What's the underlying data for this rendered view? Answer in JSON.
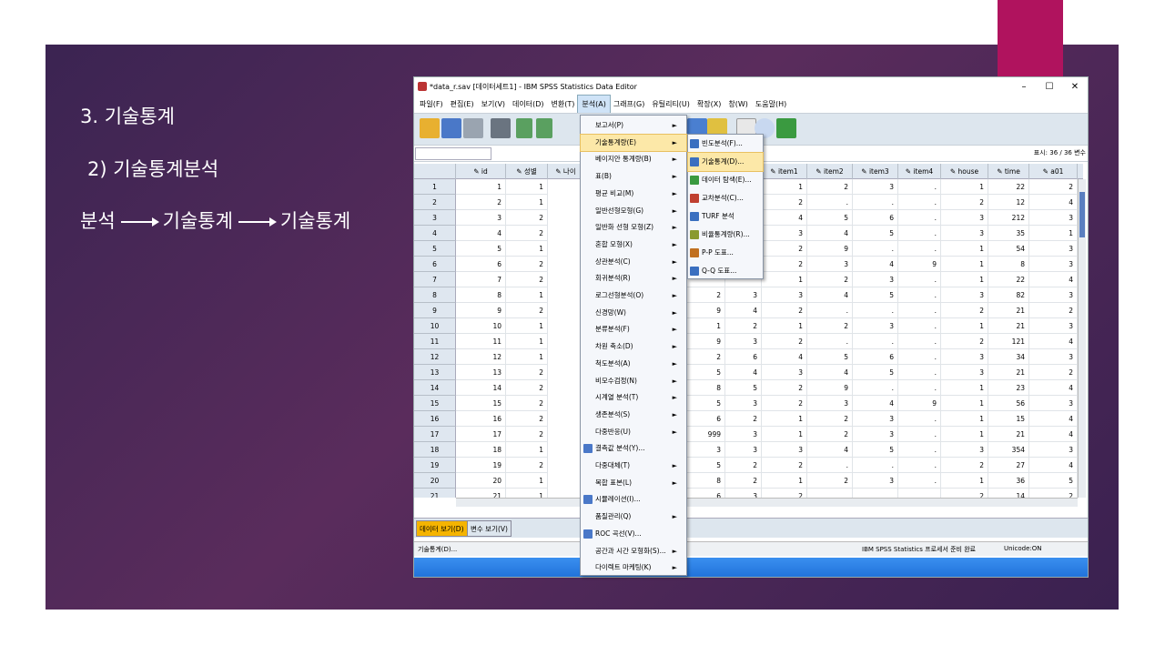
{
  "slide": {
    "heading": "3. 기술통계",
    "subheading": "2) 기술통계분석",
    "path": [
      "분석",
      "기술통계",
      "기술통계"
    ],
    "colors": {
      "background": "#4a2858",
      "accent": "#b0135e"
    }
  },
  "window": {
    "title": "*data_r.sav [데이터세트1] - IBM SPSS Statistics Data Editor",
    "controls": [
      "–",
      "☐",
      "✕"
    ],
    "menus": [
      "파일(F)",
      "편집(E)",
      "보기(V)",
      "데이터(D)",
      "변환(T)",
      "분석(A)",
      "그래프(G)",
      "유틸리티(U)",
      "확장(X)",
      "창(W)",
      "도움말(H)"
    ],
    "active_menu": "분석(A)",
    "display_info": "표시: 36 / 36 변수"
  },
  "grid": {
    "columns": [
      "id",
      "성별",
      "나이",
      "item1",
      "item2",
      "item3",
      "item4",
      "house",
      "time",
      "a01"
    ],
    "hidden_cols": [
      "",
      ""
    ],
    "rows": [
      {
        "n": "1",
        "id": "1",
        "sex": "1",
        "h1": "",
        "h2": "",
        "item1": "1",
        "item2": "2",
        "item3": "3",
        "item4": ".",
        "house": "1",
        "time": "22",
        "a01": "2"
      },
      {
        "n": "2",
        "id": "2",
        "sex": "1",
        "h1": "",
        "h2": "",
        "item1": "2",
        "item2": ".",
        "item3": ".",
        "item4": ".",
        "house": "2",
        "time": "12",
        "a01": "4"
      },
      {
        "n": "3",
        "id": "3",
        "sex": "2",
        "h1": "",
        "h2": "",
        "item1": "4",
        "item2": "5",
        "item3": "6",
        "item4": ".",
        "house": "3",
        "time": "212",
        "a01": "3"
      },
      {
        "n": "4",
        "id": "4",
        "sex": "2",
        "h1": "",
        "h2": "",
        "item1": "3",
        "item2": "4",
        "item3": "5",
        "item4": ".",
        "house": "3",
        "time": "35",
        "a01": "1"
      },
      {
        "n": "5",
        "id": "5",
        "sex": "1",
        "h1": "",
        "h2": "",
        "item1": "2",
        "item2": "9",
        "item3": ".",
        "item4": ".",
        "house": "1",
        "time": "54",
        "a01": "3"
      },
      {
        "n": "6",
        "id": "6",
        "sex": "2",
        "h1": "",
        "h2": "",
        "item1": "2",
        "item2": "3",
        "item3": "4",
        "item4": "9",
        "house": "1",
        "time": "8",
        "a01": "3"
      },
      {
        "n": "7",
        "id": "7",
        "sex": "2",
        "h1": "",
        "h2": "",
        "item1": "1",
        "item2": "2",
        "item3": "3",
        "item4": ".",
        "house": "1",
        "time": "22",
        "a01": "4"
      },
      {
        "n": "8",
        "id": "8",
        "sex": "1",
        "h1": "2",
        "h2": "3",
        "item1": "3",
        "item2": "4",
        "item3": "5",
        "item4": ".",
        "house": "3",
        "time": "82",
        "a01": "3"
      },
      {
        "n": "9",
        "id": "9",
        "sex": "2",
        "h1": "9",
        "h2": "4",
        "item1": "2",
        "item2": ".",
        "item3": ".",
        "item4": ".",
        "house": "2",
        "time": "21",
        "a01": "2"
      },
      {
        "n": "10",
        "id": "10",
        "sex": "1",
        "h1": "1",
        "h2": "2",
        "item1": "1",
        "item2": "2",
        "item3": "3",
        "item4": ".",
        "house": "1",
        "time": "21",
        "a01": "3"
      },
      {
        "n": "11",
        "id": "11",
        "sex": "1",
        "h1": "9",
        "h2": "3",
        "item1": "2",
        "item2": ".",
        "item3": ".",
        "item4": ".",
        "house": "2",
        "time": "121",
        "a01": "4"
      },
      {
        "n": "12",
        "id": "12",
        "sex": "1",
        "h1": "2",
        "h2": "6",
        "item1": "4",
        "item2": "5",
        "item3": "6",
        "item4": ".",
        "house": "3",
        "time": "34",
        "a01": "3"
      },
      {
        "n": "13",
        "id": "13",
        "sex": "2",
        "h1": "5",
        "h2": "4",
        "item1": "3",
        "item2": "4",
        "item3": "5",
        "item4": ".",
        "house": "3",
        "time": "21",
        "a01": "2"
      },
      {
        "n": "14",
        "id": "14",
        "sex": "2",
        "h1": "8",
        "h2": "5",
        "item1": "2",
        "item2": "9",
        "item3": ".",
        "item4": ".",
        "house": "1",
        "time": "23",
        "a01": "4"
      },
      {
        "n": "15",
        "id": "15",
        "sex": "2",
        "h1": "5",
        "h2": "3",
        "item1": "2",
        "item2": "3",
        "item3": "4",
        "item4": "9",
        "house": "1",
        "time": "56",
        "a01": "3"
      },
      {
        "n": "16",
        "id": "16",
        "sex": "2",
        "h1": "6",
        "h2": "2",
        "item1": "1",
        "item2": "2",
        "item3": "3",
        "item4": ".",
        "house": "1",
        "time": "15",
        "a01": "4"
      },
      {
        "n": "17",
        "id": "17",
        "sex": "2",
        "h1": "999",
        "h2": "3",
        "item1": "1",
        "item2": "2",
        "item3": "3",
        "item4": ".",
        "house": "1",
        "time": "21",
        "a01": "4"
      },
      {
        "n": "18",
        "id": "18",
        "sex": "1",
        "h1": "3",
        "h2": "3",
        "item1": "3",
        "item2": "4",
        "item3": "5",
        "item4": ".",
        "house": "3",
        "time": "354",
        "a01": "3"
      },
      {
        "n": "19",
        "id": "19",
        "sex": "2",
        "h1": "5",
        "h2": "2",
        "item1": "2",
        "item2": ".",
        "item3": ".",
        "item4": ".",
        "house": "2",
        "time": "27",
        "a01": "4"
      },
      {
        "n": "20",
        "id": "20",
        "sex": "1",
        "h1": "8",
        "h2": "2",
        "item1": "1",
        "item2": "2",
        "item3": "3",
        "item4": ".",
        "house": "1",
        "time": "36",
        "a01": "5"
      },
      {
        "n": "21",
        "id": "21",
        "sex": "1",
        "h1": "6",
        "h2": "3",
        "item1": "2",
        "item2": "",
        "item3": "",
        "item4": "",
        "house": "2",
        "time": "14",
        "a01": "2"
      }
    ]
  },
  "analyze_menu": [
    {
      "label": "보고서(P)",
      "sub": true,
      "icon": ""
    },
    {
      "label": "기술통계량(E)",
      "sub": true,
      "icon": "",
      "highlighted": true
    },
    {
      "label": "베이지안 통계량(B)",
      "sub": true,
      "icon": ""
    },
    {
      "label": "표(B)",
      "sub": true,
      "icon": ""
    },
    {
      "label": "평균 비교(M)",
      "sub": true,
      "icon": ""
    },
    {
      "label": "일반선형모형(G)",
      "sub": true,
      "icon": ""
    },
    {
      "label": "일반화 선형 모형(Z)",
      "sub": true,
      "icon": ""
    },
    {
      "label": "혼합 모형(X)",
      "sub": true,
      "icon": ""
    },
    {
      "label": "상관분석(C)",
      "sub": true,
      "icon": ""
    },
    {
      "label": "회귀분석(R)",
      "sub": true,
      "icon": ""
    },
    {
      "label": "로그선형분석(O)",
      "sub": true,
      "icon": ""
    },
    {
      "label": "신경망(W)",
      "sub": true,
      "icon": ""
    },
    {
      "label": "분류분석(F)",
      "sub": true,
      "icon": ""
    },
    {
      "label": "차원 축소(D)",
      "sub": true,
      "icon": ""
    },
    {
      "label": "척도분석(A)",
      "sub": true,
      "icon": ""
    },
    {
      "label": "비모수검정(N)",
      "sub": true,
      "icon": ""
    },
    {
      "label": "시계열 분석(T)",
      "sub": true,
      "icon": ""
    },
    {
      "label": "생존분석(S)",
      "sub": true,
      "icon": ""
    },
    {
      "label": "다중반응(U)",
      "sub": true,
      "icon": ""
    },
    {
      "label": "결측값 분석(Y)...",
      "sub": false,
      "icon": "missing-value-icon"
    },
    {
      "label": "다중대체(T)",
      "sub": true,
      "icon": ""
    },
    {
      "label": "복합 표본(L)",
      "sub": true,
      "icon": ""
    },
    {
      "label": "시뮬레이션(I)...",
      "sub": false,
      "icon": "simulation-icon"
    },
    {
      "label": "품질관리(Q)",
      "sub": true,
      "icon": ""
    },
    {
      "label": "ROC 곡선(V)...",
      "sub": false,
      "icon": "roc-curve-icon"
    },
    {
      "label": "공간과 시간 모형화(S)...",
      "sub": true,
      "icon": ""
    },
    {
      "label": "다이렉트 마케팅(K)",
      "sub": true,
      "icon": ""
    }
  ],
  "descriptives_submenu": [
    {
      "label": "빈도분석(F)...",
      "icon": "frequencies-icon",
      "color": "#3a6fc0"
    },
    {
      "label": "기술통계(D)...",
      "icon": "descriptives-icon",
      "color": "#3a6fc0",
      "highlighted": true
    },
    {
      "label": "데이터 탐색(E)...",
      "icon": "explore-icon",
      "color": "#3a9a40"
    },
    {
      "label": "교차분석(C)...",
      "icon": "crosstabs-icon",
      "color": "#c04030"
    },
    {
      "label": "TURF 분석",
      "icon": "turf-icon",
      "color": "#3a6fc0"
    },
    {
      "label": "비율통계량(R)...",
      "icon": "ratio-icon",
      "color": "#8a9a30"
    },
    {
      "label": "P-P 도표...",
      "icon": "pp-plot-icon",
      "color": "#c07020"
    },
    {
      "label": "Q-Q 도표...",
      "icon": "qq-plot-icon",
      "color": "#3a6fc0"
    }
  ],
  "tabs": {
    "data_view": "데이터 보기(D)",
    "variable_view": "변수 보기(V)"
  },
  "status": {
    "left": "기술통계(D)...",
    "processor": "IBM SPSS Statistics 프로세서 준비 완료",
    "unicode": "Unicode:ON"
  }
}
